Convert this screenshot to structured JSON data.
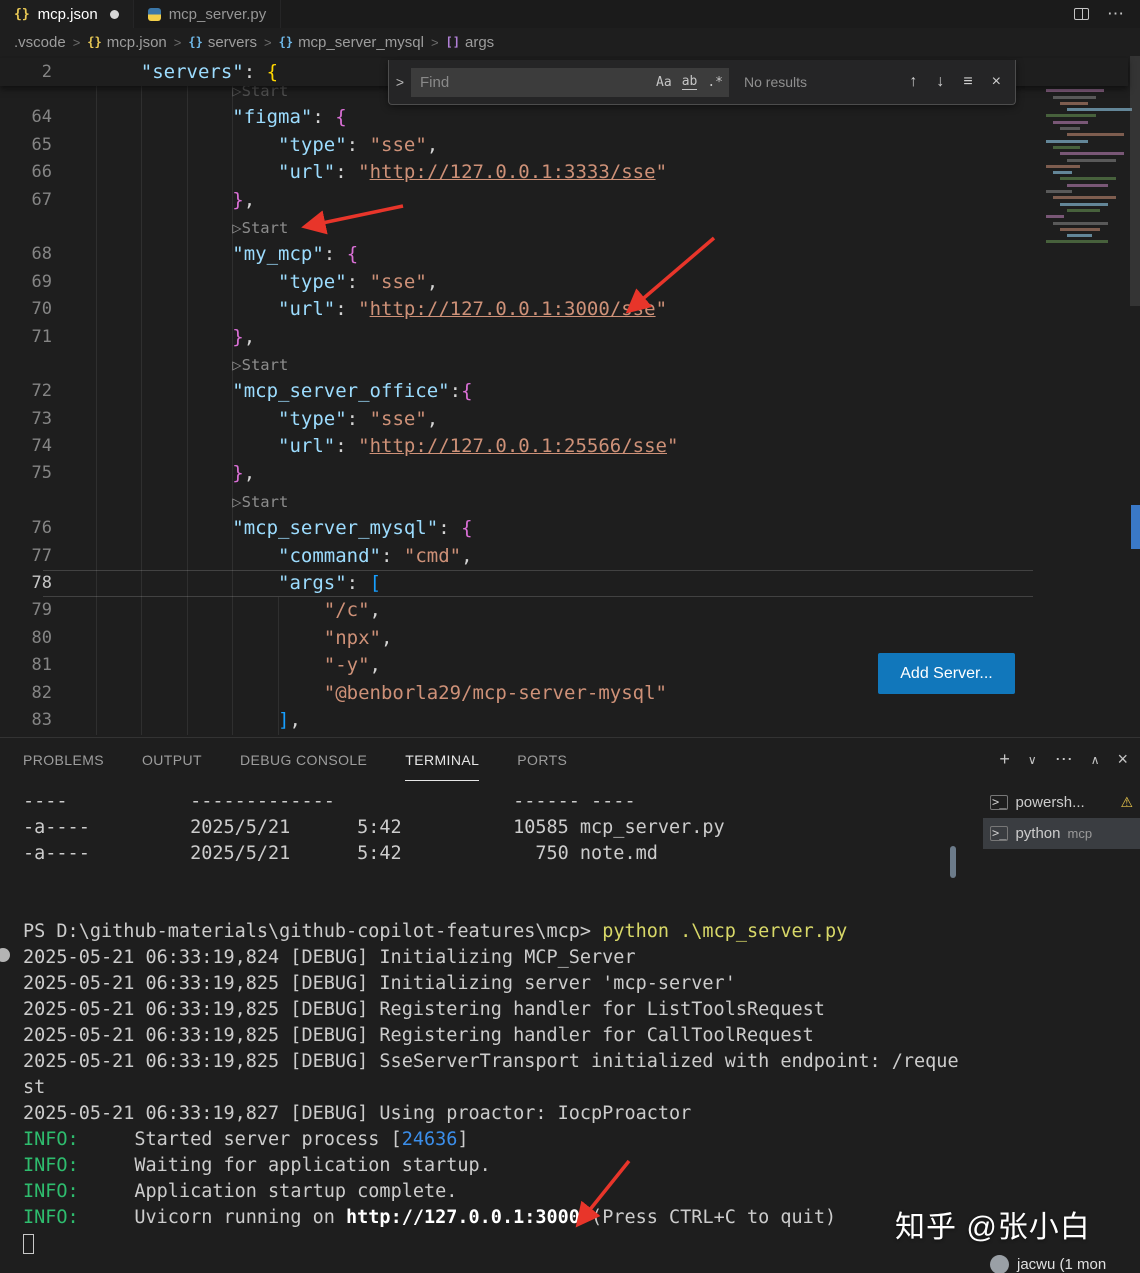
{
  "window": {
    "tabs": [
      {
        "label": "mcp.json",
        "icon": "json",
        "modified": true,
        "active": true
      },
      {
        "label": "mcp_server.py",
        "icon": "python",
        "modified": false,
        "active": false
      }
    ]
  },
  "breadcrumb": {
    "items": [
      {
        "label": ".vscode",
        "icon": "",
        "icon_color": ""
      },
      {
        "label": "mcp.json",
        "icon": "{}",
        "icon_color": "#e8c855"
      },
      {
        "label": "servers",
        "icon": "{}",
        "icon_color": "#6fb8e8"
      },
      {
        "label": "mcp_server_mysql",
        "icon": "{}",
        "icon_color": "#6fb8e8"
      },
      {
        "label": "args",
        "icon": "[]",
        "icon_color": "#b180d7"
      }
    ]
  },
  "find": {
    "placeholder": "Find",
    "case_label": "Aa",
    "word_label": "ab",
    "regex_label": ".*",
    "results": "No results"
  },
  "editor": {
    "add_server": "Add Server...",
    "sticky": {
      "num": "2",
      "tokens": [
        {
          "t": "    ",
          "c": "t"
        },
        {
          "t": "\"servers\"",
          "c": "k"
        },
        {
          "t": ": ",
          "c": "p"
        },
        {
          "t": "{",
          "c": "b1"
        }
      ]
    },
    "rows": [
      {
        "type": "lens",
        "dim": true,
        "tokens": [
          {
            "t": "            ",
            "c": "t"
          },
          {
            "t": "▷",
            "c": "lens"
          },
          {
            "t": "Start",
            "c": "lens"
          }
        ]
      },
      {
        "type": "code",
        "num": "64",
        "tokens": [
          {
            "t": "            ",
            "c": "t"
          },
          {
            "t": "\"figma\"",
            "c": "k"
          },
          {
            "t": ": ",
            "c": "p"
          },
          {
            "t": "{",
            "c": "b2"
          }
        ]
      },
      {
        "type": "code",
        "num": "65",
        "tokens": [
          {
            "t": "                ",
            "c": "t"
          },
          {
            "t": "\"type\"",
            "c": "k"
          },
          {
            "t": ": ",
            "c": "p"
          },
          {
            "t": "\"sse\"",
            "c": "s"
          },
          {
            "t": ",",
            "c": "p"
          }
        ]
      },
      {
        "type": "code",
        "num": "66",
        "tokens": [
          {
            "t": "                ",
            "c": "t"
          },
          {
            "t": "\"url\"",
            "c": "k"
          },
          {
            "t": ": ",
            "c": "p"
          },
          {
            "t": "\"",
            "c": "s"
          },
          {
            "t": "http://127.0.0.1:3333/sse",
            "c": "u"
          },
          {
            "t": "\"",
            "c": "s"
          }
        ]
      },
      {
        "type": "code",
        "num": "67",
        "tokens": [
          {
            "t": "            ",
            "c": "t"
          },
          {
            "t": "}",
            "c": "b2"
          },
          {
            "t": ",",
            "c": "p"
          }
        ]
      },
      {
        "type": "lens",
        "tokens": [
          {
            "t": "            ",
            "c": "t"
          },
          {
            "t": "▷",
            "c": "lens"
          },
          {
            "t": "Start",
            "c": "lens"
          }
        ]
      },
      {
        "type": "code",
        "num": "68",
        "tokens": [
          {
            "t": "            ",
            "c": "t"
          },
          {
            "t": "\"my_mcp\"",
            "c": "k"
          },
          {
            "t": ": ",
            "c": "p"
          },
          {
            "t": "{",
            "c": "b2"
          }
        ]
      },
      {
        "type": "code",
        "num": "69",
        "tokens": [
          {
            "t": "                ",
            "c": "t"
          },
          {
            "t": "\"type\"",
            "c": "k"
          },
          {
            "t": ": ",
            "c": "p"
          },
          {
            "t": "\"sse\"",
            "c": "s"
          },
          {
            "t": ",",
            "c": "p"
          }
        ]
      },
      {
        "type": "code",
        "num": "70",
        "tokens": [
          {
            "t": "                ",
            "c": "t"
          },
          {
            "t": "\"url\"",
            "c": "k"
          },
          {
            "t": ": ",
            "c": "p"
          },
          {
            "t": "\"",
            "c": "s"
          },
          {
            "t": "http://127.0.0.1:3000/sse",
            "c": "u"
          },
          {
            "t": "\"",
            "c": "s"
          }
        ]
      },
      {
        "type": "code",
        "num": "71",
        "tokens": [
          {
            "t": "            ",
            "c": "t"
          },
          {
            "t": "}",
            "c": "b2"
          },
          {
            "t": ",",
            "c": "p"
          }
        ]
      },
      {
        "type": "lens",
        "tokens": [
          {
            "t": "            ",
            "c": "t"
          },
          {
            "t": "▷",
            "c": "lens"
          },
          {
            "t": "Start",
            "c": "lens"
          }
        ]
      },
      {
        "type": "code",
        "num": "72",
        "tokens": [
          {
            "t": "            ",
            "c": "t"
          },
          {
            "t": "\"mcp_server_office\"",
            "c": "k"
          },
          {
            "t": ":",
            "c": "p"
          },
          {
            "t": "{",
            "c": "b2"
          }
        ]
      },
      {
        "type": "code",
        "num": "73",
        "tokens": [
          {
            "t": "                ",
            "c": "t"
          },
          {
            "t": "\"type\"",
            "c": "k"
          },
          {
            "t": ": ",
            "c": "p"
          },
          {
            "t": "\"sse\"",
            "c": "s"
          },
          {
            "t": ",",
            "c": "p"
          }
        ]
      },
      {
        "type": "code",
        "num": "74",
        "tokens": [
          {
            "t": "                ",
            "c": "t"
          },
          {
            "t": "\"url\"",
            "c": "k"
          },
          {
            "t": ": ",
            "c": "p"
          },
          {
            "t": "\"",
            "c": "s"
          },
          {
            "t": "http://127.0.0.1:25566/sse",
            "c": "u"
          },
          {
            "t": "\"",
            "c": "s"
          }
        ]
      },
      {
        "type": "code",
        "num": "75",
        "tokens": [
          {
            "t": "            ",
            "c": "t"
          },
          {
            "t": "}",
            "c": "b2"
          },
          {
            "t": ",",
            "c": "p"
          }
        ]
      },
      {
        "type": "lens",
        "tokens": [
          {
            "t": "            ",
            "c": "t"
          },
          {
            "t": "▷",
            "c": "lens"
          },
          {
            "t": "Start",
            "c": "lens"
          }
        ]
      },
      {
        "type": "code",
        "num": "76",
        "tokens": [
          {
            "t": "            ",
            "c": "t"
          },
          {
            "t": "\"mcp_server_mysql\"",
            "c": "k"
          },
          {
            "t": ": ",
            "c": "p"
          },
          {
            "t": "{",
            "c": "b2"
          }
        ]
      },
      {
        "type": "code",
        "num": "77",
        "tokens": [
          {
            "t": "                ",
            "c": "t"
          },
          {
            "t": "\"command\"",
            "c": "k"
          },
          {
            "t": ": ",
            "c": "p"
          },
          {
            "t": "\"cmd\"",
            "c": "s"
          },
          {
            "t": ",",
            "c": "p"
          }
        ]
      },
      {
        "type": "code",
        "num": "78",
        "cur": true,
        "tokens": [
          {
            "t": "                ",
            "c": "t"
          },
          {
            "t": "\"args\"",
            "c": "k"
          },
          {
            "t": ": ",
            "c": "p"
          },
          {
            "t": "[",
            "c": "b3"
          }
        ]
      },
      {
        "type": "code",
        "num": "79",
        "tokens": [
          {
            "t": "                    ",
            "c": "t"
          },
          {
            "t": "\"/c\"",
            "c": "s"
          },
          {
            "t": ",",
            "c": "p"
          }
        ]
      },
      {
        "type": "code",
        "num": "80",
        "tokens": [
          {
            "t": "                    ",
            "c": "t"
          },
          {
            "t": "\"npx\"",
            "c": "s"
          },
          {
            "t": ",",
            "c": "p"
          }
        ]
      },
      {
        "type": "code",
        "num": "81",
        "tokens": [
          {
            "t": "                    ",
            "c": "t"
          },
          {
            "t": "\"-y\"",
            "c": "s"
          },
          {
            "t": ",",
            "c": "p"
          }
        ]
      },
      {
        "type": "code",
        "num": "82",
        "tokens": [
          {
            "t": "                    ",
            "c": "t"
          },
          {
            "t": "\"@benborla29/mcp-server-mysql\"",
            "c": "s"
          }
        ]
      },
      {
        "type": "code",
        "num": "83",
        "tokens": [
          {
            "t": "                ",
            "c": "t"
          },
          {
            "t": "]",
            "c": "b3"
          },
          {
            "t": ",",
            "c": "p"
          }
        ]
      }
    ]
  },
  "panel": {
    "tabs": [
      {
        "label": "PROBLEMS",
        "active": false
      },
      {
        "label": "OUTPUT",
        "active": false
      },
      {
        "label": "DEBUG CONSOLE",
        "active": false
      },
      {
        "label": "TERMINAL",
        "active": true
      },
      {
        "label": "PORTS",
        "active": false
      }
    ]
  },
  "terminal": {
    "lines": [
      {
        "tokens": [
          {
            "t": "----           -------------                ------ ----",
            "c": "t"
          }
        ]
      },
      {
        "tokens": [
          {
            "t": "-a----         2025/5/21      5:42          10585 mcp_server.py",
            "c": "t"
          }
        ]
      },
      {
        "tokens": [
          {
            "t": "-a----         2025/5/21      5:42            750 note.md",
            "c": "t"
          }
        ]
      },
      {
        "tokens": []
      },
      {
        "tokens": []
      },
      {
        "tokens": [
          {
            "t": "PS D:\\github-materials\\github-copilot-features\\mcp> ",
            "c": "t"
          },
          {
            "t": "python .\\mcp_server.py",
            "c": "y"
          }
        ]
      },
      {
        "tokens": [
          {
            "t": "2025-05-21 06:33:19,824 [DEBUG] Initializing MCP_Server",
            "c": "t"
          }
        ]
      },
      {
        "tokens": [
          {
            "t": "2025-05-21 06:33:19,825 [DEBUG] Initializing server 'mcp-server'",
            "c": "t"
          }
        ]
      },
      {
        "tokens": [
          {
            "t": "2025-05-21 06:33:19,825 [DEBUG] Registering handler for ListToolsRequest",
            "c": "t"
          }
        ]
      },
      {
        "tokens": [
          {
            "t": "2025-05-21 06:33:19,825 [DEBUG] Registering handler for CallToolRequest",
            "c": "t"
          }
        ]
      },
      {
        "tokens": [
          {
            "t": "2025-05-21 06:33:19,825 [DEBUG] SseServerTransport initialized with endpoint: /reque",
            "c": "t"
          }
        ]
      },
      {
        "tokens": [
          {
            "t": "st",
            "c": "t"
          }
        ]
      },
      {
        "tokens": [
          {
            "t": "2025-05-21 06:33:19,827 [DEBUG] Using proactor: IocpProactor",
            "c": "t"
          }
        ]
      },
      {
        "tokens": [
          {
            "t": "INFO:",
            "c": "g"
          },
          {
            "t": "     Started server process [",
            "c": "t"
          },
          {
            "t": "24636",
            "c": "bl"
          },
          {
            "t": "]",
            "c": "t"
          }
        ]
      },
      {
        "tokens": [
          {
            "t": "INFO:",
            "c": "g"
          },
          {
            "t": "     Waiting for application startup.",
            "c": "t"
          }
        ]
      },
      {
        "tokens": [
          {
            "t": "INFO:",
            "c": "g"
          },
          {
            "t": "     Application startup complete.",
            "c": "t"
          }
        ]
      },
      {
        "tokens": [
          {
            "t": "INFO:",
            "c": "g"
          },
          {
            "t": "     Uvicorn running on ",
            "c": "t"
          },
          {
            "t": "http://127.0.0.1:3000",
            "c": "w"
          },
          {
            "t": " (Press CTRL+C to quit)",
            "c": "t"
          }
        ]
      },
      {
        "cursor": true
      }
    ],
    "sidebar": [
      {
        "label": "powersh...",
        "desc": "",
        "warn": true,
        "selected": false
      },
      {
        "label": "python",
        "desc": "mcp",
        "warn": false,
        "selected": true
      }
    ]
  },
  "watermark": "知乎 @张小白",
  "page_footer": "jacwu (1 mon"
}
